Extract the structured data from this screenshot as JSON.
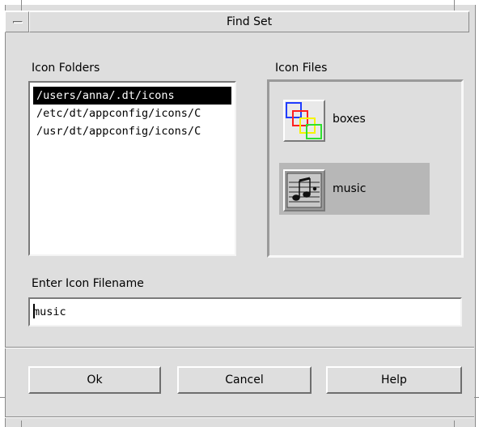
{
  "window": {
    "title": "Find Set"
  },
  "folders": {
    "label": "Icon Folders",
    "items": [
      {
        "label": "/users/anna/.dt/icons",
        "selected": true
      },
      {
        "label": "/etc/dt/appconfig/icons/C",
        "selected": false
      },
      {
        "label": "/usr/dt/appconfig/icons/C",
        "selected": false
      }
    ]
  },
  "files": {
    "label": "Icon Files",
    "items": [
      {
        "label": "boxes",
        "icon": "boxes-icon",
        "selected": false
      },
      {
        "label": "music",
        "icon": "music-icon",
        "selected": true
      }
    ]
  },
  "filename": {
    "label": "Enter Icon Filename",
    "value": "music"
  },
  "buttons": {
    "ok": "Ok",
    "cancel": "Cancel",
    "help": "Help"
  },
  "colors": {
    "window_bg": "#dedede",
    "selection_bg": "#000000",
    "selected_file_bg": "#b7b7b7",
    "boxes_blue": "#1f3cff",
    "boxes_red": "#ff1f1f",
    "boxes_yellow": "#f4f400",
    "boxes_green": "#2fe02f"
  }
}
